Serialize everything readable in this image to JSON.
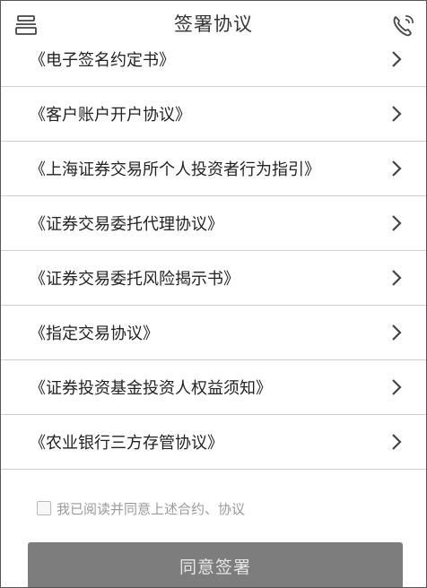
{
  "header": {
    "title": "签署协议",
    "left_icon": "menu-icon",
    "right_icon": "phone-icon"
  },
  "agreements": [
    {
      "label": "《电子签名约定书》"
    },
    {
      "label": "《客户账户开户协议》"
    },
    {
      "label": "《上海证券交易所个人投资者行为指引》"
    },
    {
      "label": "《证券交易委托代理协议》"
    },
    {
      "label": "《证券交易委托风险揭示书》"
    },
    {
      "label": "《指定交易协议》"
    },
    {
      "label": "《证券投资基金投资人权益须知》"
    },
    {
      "label": "《农业银行三方存管协议》"
    }
  ],
  "consent": {
    "checked": false,
    "text": "我已阅读并同意上述合约、协议"
  },
  "submit": {
    "label": "同意签署"
  }
}
